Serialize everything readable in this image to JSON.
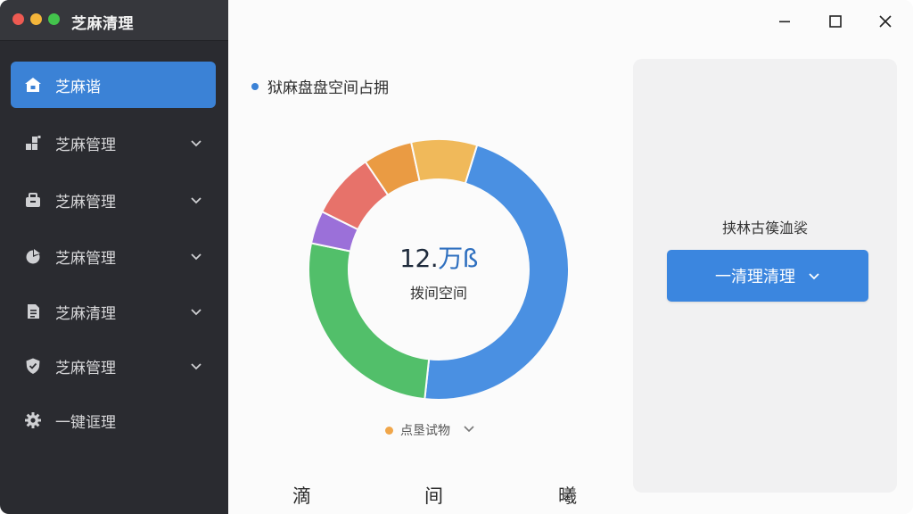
{
  "app": {
    "title": "芝麻清理"
  },
  "sidebar": {
    "items": [
      {
        "label": "芝麻谐",
        "icon": "home-icon",
        "active": true,
        "has_chevron": false
      },
      {
        "label": "芝麻管理",
        "icon": "blocks-icon",
        "active": false,
        "has_chevron": true
      },
      {
        "label": "芝麻管理",
        "icon": "briefcase-icon",
        "active": false,
        "has_chevron": true
      },
      {
        "label": "芝麻管理",
        "icon": "pie-icon",
        "active": false,
        "has_chevron": true
      },
      {
        "label": "芝麻清理",
        "icon": "document-icon",
        "active": false,
        "has_chevron": true
      },
      {
        "label": "芝麻管理",
        "icon": "shield-icon",
        "active": false,
        "has_chevron": true
      },
      {
        "label": "一键诓理",
        "icon": "gear-icon",
        "active": false,
        "has_chevron": false
      }
    ]
  },
  "window_controls": {
    "minimize": "minimize-icon",
    "maximize": "maximize-icon",
    "close": "close-icon"
  },
  "main": {
    "section_title": "狱麻盘盘空间占拥",
    "donut": {
      "value": "12.",
      "unit": "万ß",
      "label": "拨间空间",
      "colors": [
        "#4a90e2",
        "#52bf6a",
        "#9b70d9",
        "#e7726a",
        "#ea9b43",
        "#f0b95a"
      ],
      "fractions": [
        0.46,
        0.26,
        0.04,
        0.08,
        0.06,
        0.08
      ]
    },
    "legend": {
      "label": "点垦试物",
      "color": "#f0a64a"
    },
    "bottom_labels": [
      "滴",
      "间",
      "曦"
    ]
  },
  "panel": {
    "label": "挟林古篌洫裟",
    "button_label": "一清理清理"
  },
  "colors": {
    "accent": "#3b82d6",
    "sidebar_bg": "#2a2b30"
  }
}
